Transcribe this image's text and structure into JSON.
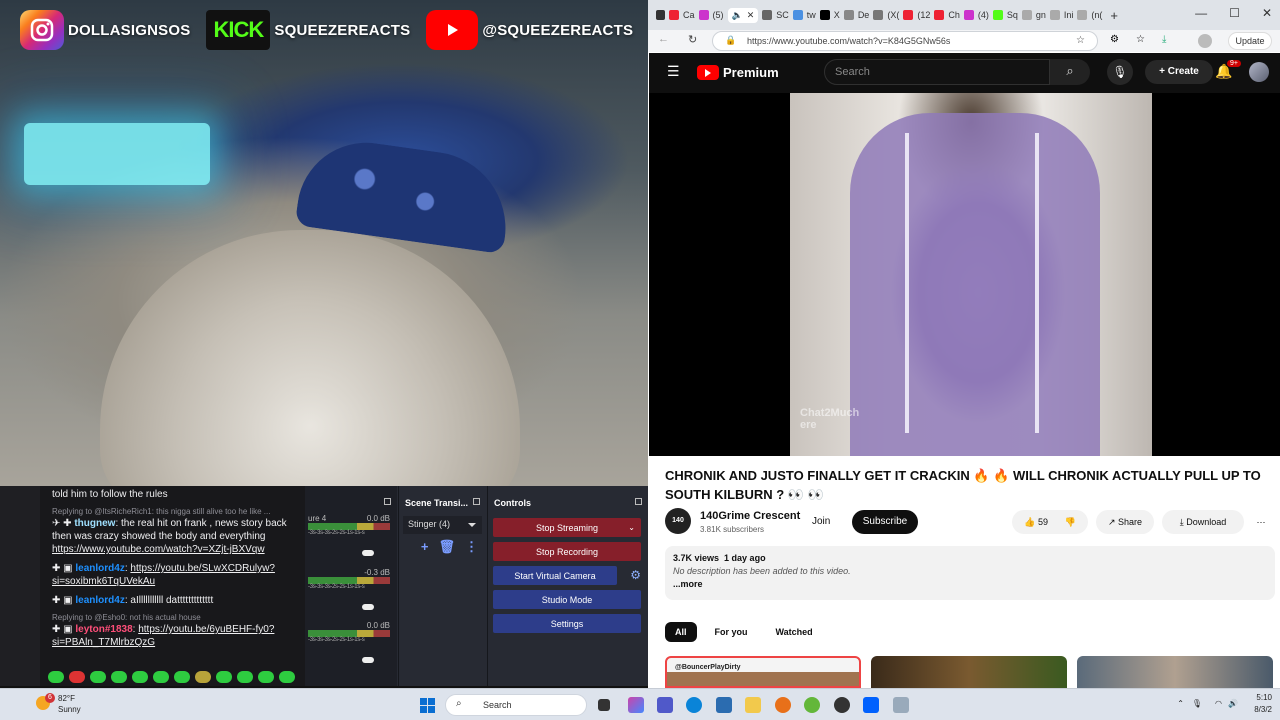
{
  "overlay": {
    "instagram": {
      "handle": "DOLLASIGNSOS",
      "icon": "instagram-icon"
    },
    "kick": {
      "logo": "KICK",
      "handle": "SQUEEZEREACTS"
    },
    "youtube": {
      "handle": "@SQUEEZEREACTS",
      "icon": "youtube-icon"
    }
  },
  "chat": {
    "first_line": "told him to follow the rules",
    "reply1": "Replying to @ItsRicheRich1: this nigga still alive too he like ...",
    "m1_user": "thugnew",
    "m1_text": " the real hit on frank , news story back then was crazy showed the body and everything ",
    "m1_link": "https://www.youtube.com/watch?v=XZjt-jBXVqw",
    "m2_user": "leanlord4z",
    "m2_link": "https://youtu.be/SLwXCDRulyw?si=soxibmk6TqUVekAu",
    "m3_user": "leanlord4z",
    "m3_text": " aIlllllllllll dattttttttttttt",
    "reply2": "Replying to @Esho0: not his actual house",
    "m4_user": "leyton#1838",
    "m4_link": "https://youtu.be/6yuBEHF-fy0?si=PBAln_T7MlrbzQzG"
  },
  "obs": {
    "mixer": [
      {
        "label": "ure 4",
        "db": "0.0 dB",
        "scale": "-3s-3s-3s-2s-2s-1s-1s-s"
      },
      {
        "label": "",
        "db": "-0.3 dB",
        "scale": "-3s-3s-3s-2s-2s-1s-1s-s"
      },
      {
        "label": "",
        "db": "0.0 dB",
        "scale": "-3s-3s-3s-2s-2s-1s-1s-s"
      }
    ],
    "scene_transitions_title": "Scene Transi...",
    "transition_select": "Stinger (4)",
    "controls_title": "Controls",
    "buttons": {
      "stop_streaming": "Stop Streaming",
      "stop_recording": "Stop Recording",
      "virtual_camera": "Start Virtual Camera",
      "studio_mode": "Studio Mode",
      "settings": "Settings"
    }
  },
  "browser": {
    "tabs": [
      "Ca",
      "(5)",
      "SC",
      "tw",
      "X",
      "De",
      "(X(",
      "(12",
      "Ch",
      "(4)",
      "Sq",
      "gn",
      "Ini",
      "(n("
    ],
    "url": "https://www.youtube.com/watch?v=K84G5GNw56s",
    "update_label": "Update"
  },
  "youtube": {
    "brand": "Premium",
    "search_placeholder": "Search",
    "create_label": "Create",
    "notif_count": "9+",
    "watermark": "Chat2Much",
    "watermark2": "ere",
    "title": "CHRONIK AND JUSTO FINALLY GET IT CRACKIN 🔥 🔥 WILL CHRONIK ACTUALLY PULL UP TO SOUTH KILBURN ? 👀 👀",
    "channel_avatar": "140",
    "channel_name": "140Grime Crescent",
    "subscribers": "3.81K subscribers",
    "join": "Join",
    "subscribe": "Subscribe",
    "likes": "59",
    "share": "Share",
    "download": "Download",
    "views": "3.7K views",
    "age": "1 day ago",
    "no_desc": "No description has been added to this video.",
    "more": "...more",
    "chips": [
      "All",
      "For you",
      "Watched"
    ],
    "thumb1_text": "@BouncerPlayDirty"
  },
  "taskbar": {
    "temp": "82°F",
    "condition": "Sunny",
    "weather_badge": "6",
    "search": "Search",
    "time": "5:10",
    "date": "8/3/2"
  }
}
